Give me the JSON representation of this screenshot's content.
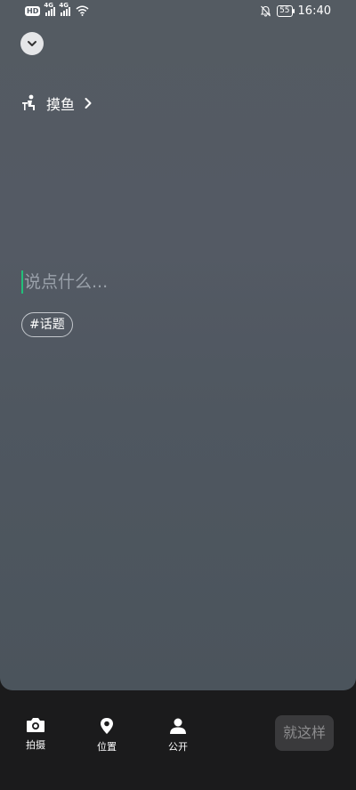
{
  "status_bar": {
    "network_badge": "HD",
    "signal_1_label": "4G",
    "signal_2_label": "4G",
    "battery": "55",
    "time": "16:40"
  },
  "header": {
    "collapse_icon": "chevron-down-icon"
  },
  "mood": {
    "icon": "person-at-desk-icon",
    "label": "摸鱼"
  },
  "composer": {
    "placeholder": "说点什么...",
    "value": ""
  },
  "topic": {
    "label": "#话题"
  },
  "toolbar": {
    "items": [
      {
        "icon": "camera-icon",
        "label": "拍摄"
      },
      {
        "icon": "location-pin-icon",
        "label": "位置"
      },
      {
        "icon": "person-icon",
        "label": "公开"
      }
    ],
    "submit_label": "就这样"
  },
  "colors": {
    "caret": "#22c07a",
    "bottom_bar": "#1b1b1c",
    "submit_bg": "#3a3a3c"
  }
}
